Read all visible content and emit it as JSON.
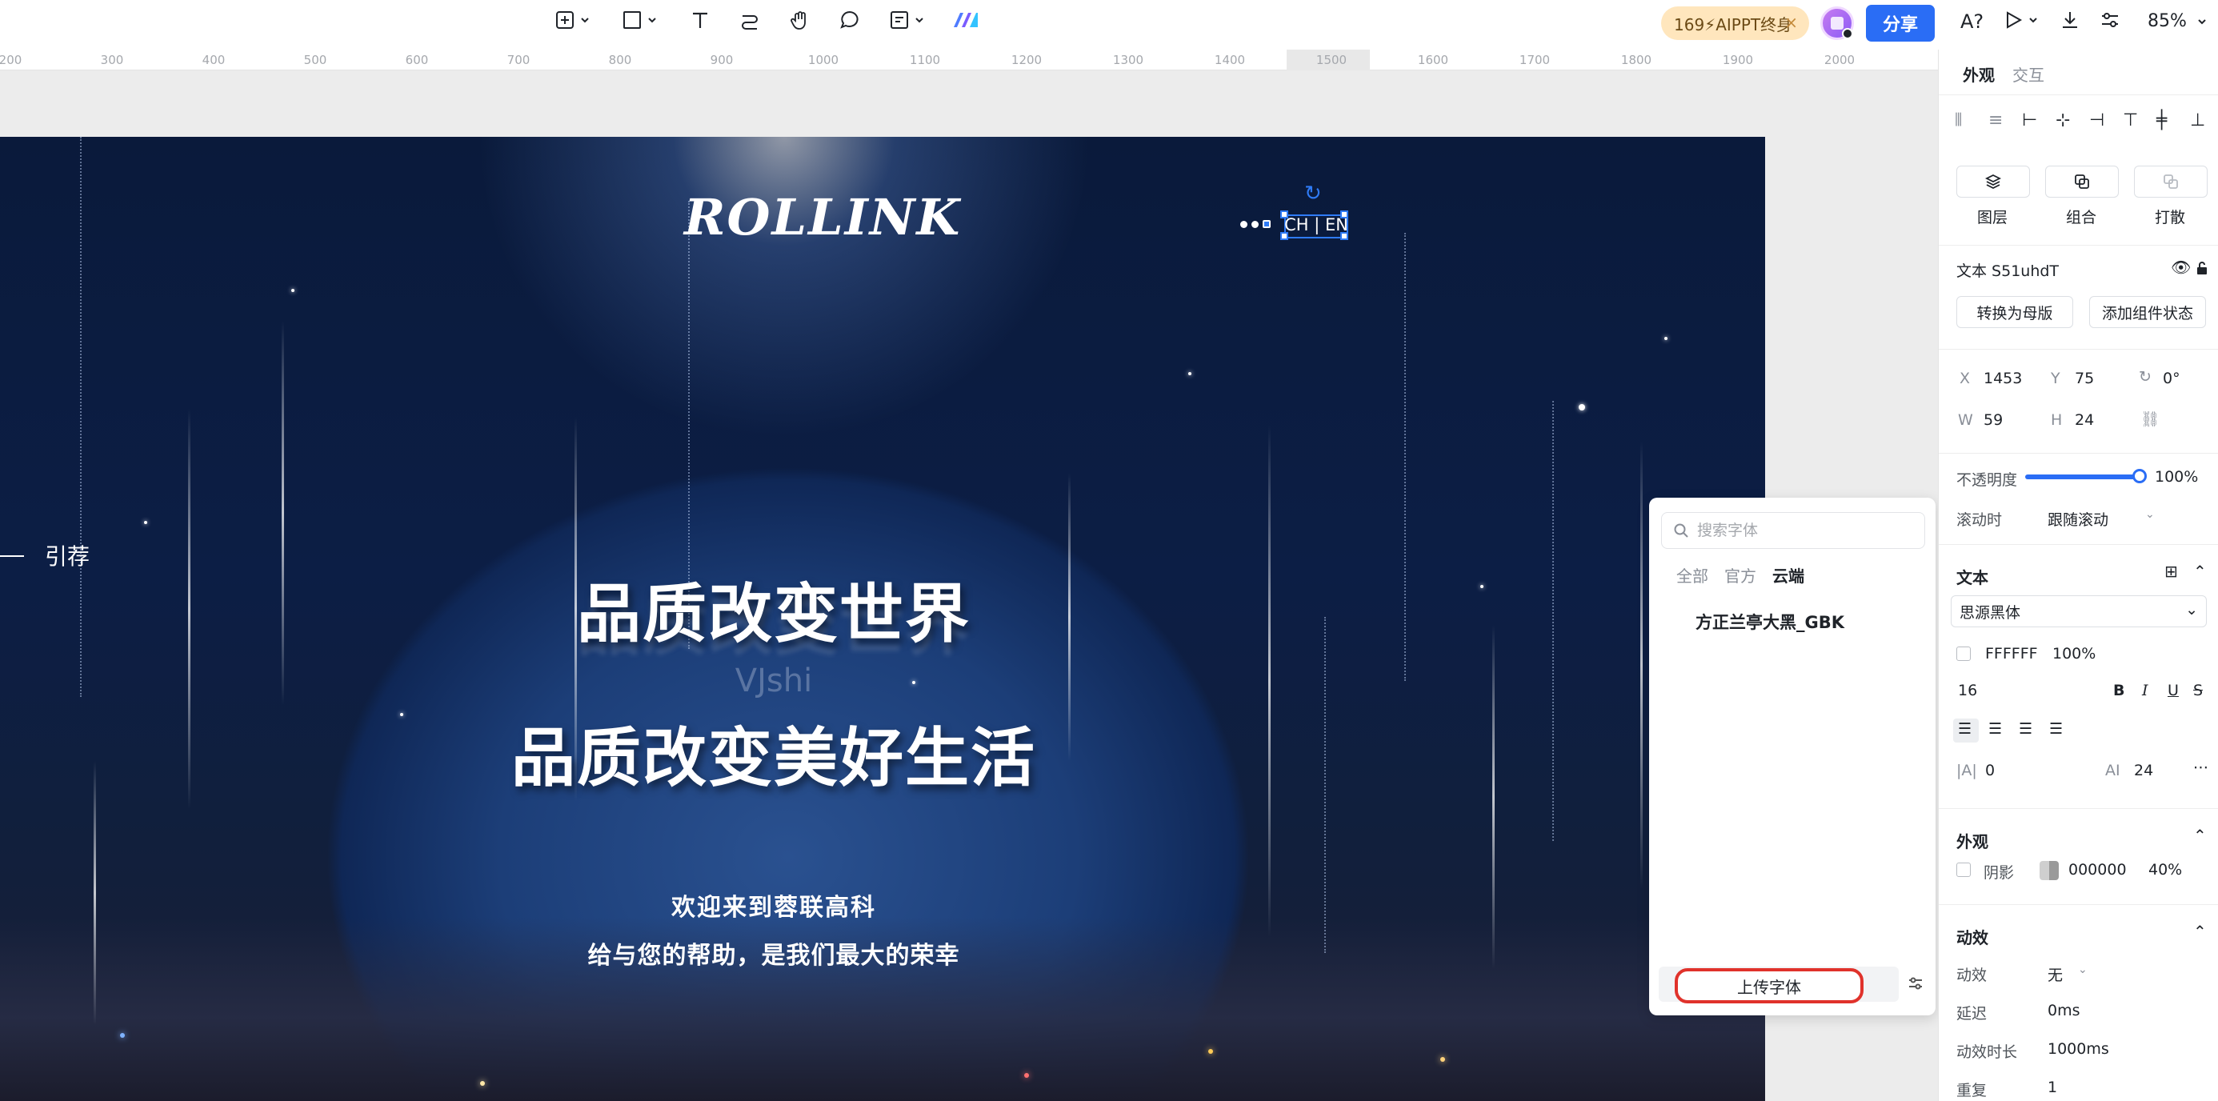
{
  "toolbar": {
    "tools": [
      "add-icon",
      "rectangle-icon",
      "text-icon",
      "connector-icon",
      "hand-icon",
      "comment-icon",
      "note-icon",
      "ai-icon"
    ],
    "ai_badge": "169⚡AIPPT终身",
    "share_label": "分享",
    "zoom": "85%"
  },
  "ruler": {
    "ticks": [
      "200",
      "300",
      "400",
      "500",
      "600",
      "700",
      "800",
      "900",
      "1000",
      "1100",
      "1200",
      "1300",
      "1400",
      "1500",
      "1600",
      "1700",
      "1800",
      "1900",
      "2000"
    ]
  },
  "slide": {
    "logo": "ROLLINK",
    "lang_switch": "CH | EN",
    "recommend": "引荐",
    "hero_line1": "品质改变世界",
    "watermark": "VJshi",
    "hero_line2": "品质改变美好生活",
    "welcome": "欢迎来到蓉联高科",
    "slogan": "给与您的帮助，是我们最大的荣幸"
  },
  "font_panel": {
    "search_placeholder": "搜索字体",
    "tabs": [
      "全部",
      "官方",
      "云端"
    ],
    "active_tab": "云端",
    "fonts": [
      "方正兰亭大黑_GBK"
    ],
    "upload_label": "上传字体"
  },
  "right_panel": {
    "tabs": [
      "外观",
      "交互"
    ],
    "layer_label": "图层",
    "group_label": "组合",
    "scatter_label": "打散",
    "element_name": "文本 S51uhdT",
    "to_master": "转换为母版",
    "add_state": "添加组件状态",
    "x_label": "X",
    "x": "1453",
    "y_label": "Y",
    "y": "75",
    "rotation": "0°",
    "w_label": "W",
    "w": "59",
    "h_label": "H",
    "h": "24",
    "opacity_label": "不透明度",
    "opacity": "100%",
    "opacity_level": 1.0,
    "scroll_label": "滚动时",
    "scroll_value": "跟随滚动",
    "text_head": "文本",
    "font_family": "思源黑体",
    "color": "FFFFFF",
    "color_opacity": "100%",
    "font_size": "16",
    "letter_spacing": "0",
    "line_height": "24",
    "appearance_head": "外观",
    "shadow_label": "阴影",
    "shadow_color": "000000",
    "shadow_opacity": "40%",
    "animation_head": "动效",
    "anim_label": "动效",
    "anim_value": "无",
    "delay_label": "延迟",
    "delay_value": "0ms",
    "duration_label": "动效时长",
    "duration_value": "1000ms",
    "repeat_label": "重复",
    "repeat_value": "1"
  },
  "colors": {
    "accent": "#2a6df5",
    "highlight_red": "#e0322b",
    "badge_bg": "#ffe6bd"
  }
}
